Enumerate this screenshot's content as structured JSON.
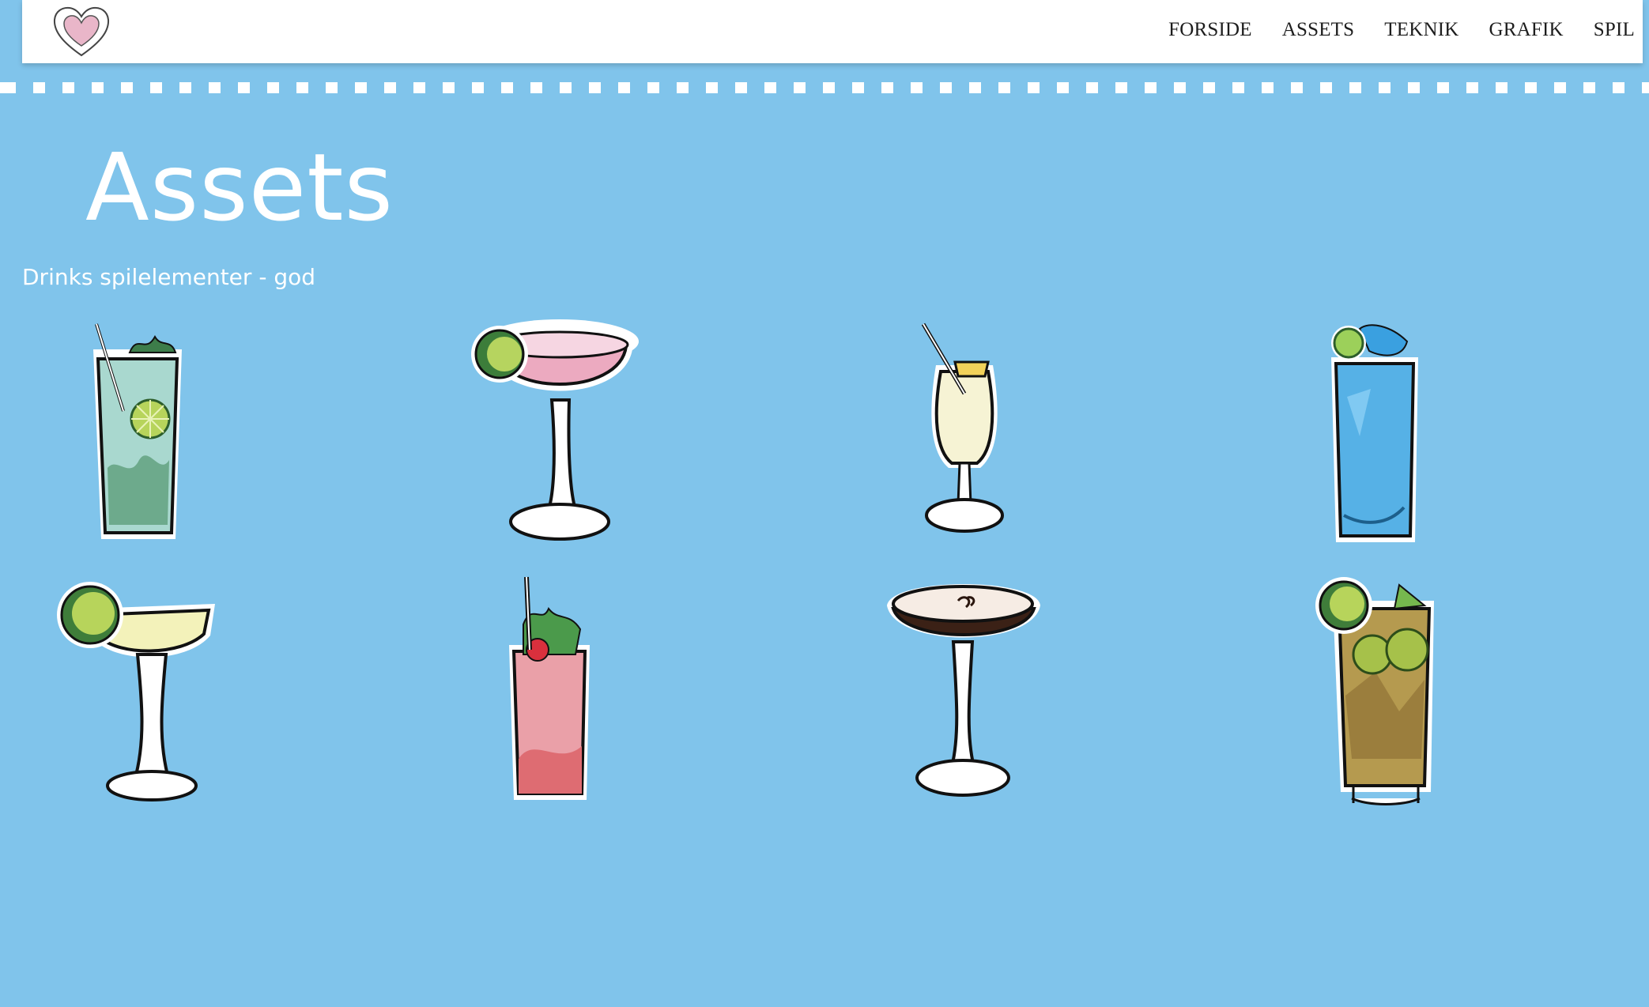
{
  "nav": {
    "items": [
      {
        "label": "FORSIDE"
      },
      {
        "label": "ASSETS"
      },
      {
        "label": "TEKNIK"
      },
      {
        "label": "GRAFIK"
      },
      {
        "label": "SPIL"
      }
    ]
  },
  "page": {
    "title": "Assets",
    "section_label": "Drinks spilelementer - god"
  },
  "icons": {
    "logo": "heart-icon",
    "drinks": [
      "mojito-icon",
      "pink-coupe-cocktail-icon",
      "pina-colada-icon",
      "blue-highball-icon",
      "margarita-icon",
      "strawberry-mojito-icon",
      "espresso-martini-icon",
      "long-island-icon"
    ]
  },
  "colors": {
    "background": "#80c4eb",
    "header": "#ffffff",
    "text_white": "#ffffff",
    "nav_text": "#1d1d1d"
  }
}
